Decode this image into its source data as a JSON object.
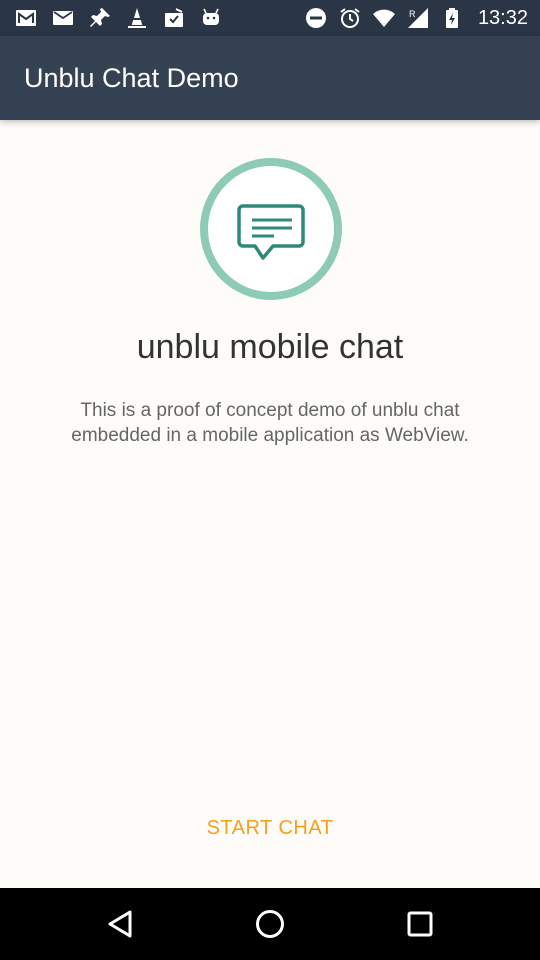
{
  "status_bar": {
    "time": "13:32",
    "left_icons": [
      "gmail-icon",
      "mail-icon",
      "pin-icon",
      "vlc-icon",
      "clipboard-check-icon",
      "android-icon"
    ],
    "right_icons": [
      "do-not-disturb-icon",
      "alarm-icon",
      "wifi-icon",
      "cell-signal-icon",
      "battery-icon"
    ]
  },
  "app_bar": {
    "title": "Unblu Chat Demo"
  },
  "main": {
    "logo_icon": "chat-bubble-icon",
    "headline": "unblu mobile chat",
    "description": "This is a proof of concept demo of unblu chat embedded in a mobile application as WebView.",
    "start_button_label": "START CHAT"
  },
  "nav_bar": {
    "buttons": [
      "back-icon",
      "home-icon",
      "recents-icon"
    ]
  },
  "colors": {
    "status_bar": "#2a3545",
    "app_bar": "#354253",
    "accent_orange": "#f5a11b",
    "logo_ring": "#8ecbb6",
    "logo_icon": "#2e8a78",
    "background": "#fdfcf8"
  }
}
